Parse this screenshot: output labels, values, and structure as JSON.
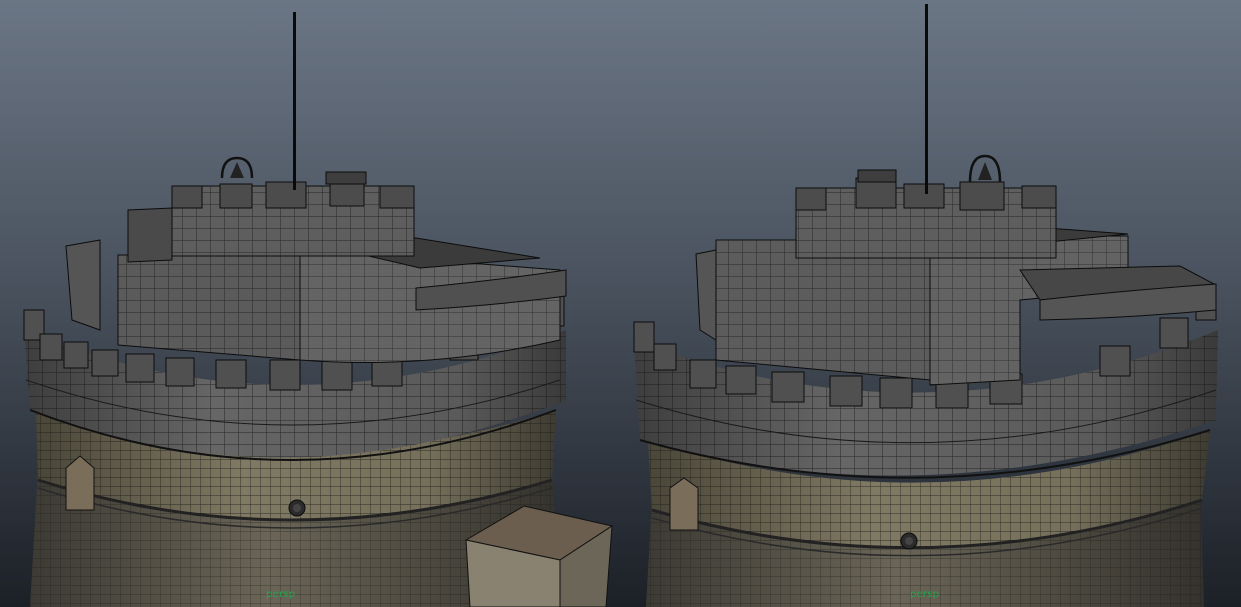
{
  "viewports": [
    {
      "camera_label": "persp"
    },
    {
      "camera_label": "persp"
    }
  ],
  "colors": {
    "background_top": "#6b7685",
    "background_bottom": "#1c2027",
    "wireframe": "#0c0c0c",
    "stone_grey": "#5c5c5c",
    "brick_tan": "#7b7560",
    "camera_label": "#1fa84a"
  }
}
